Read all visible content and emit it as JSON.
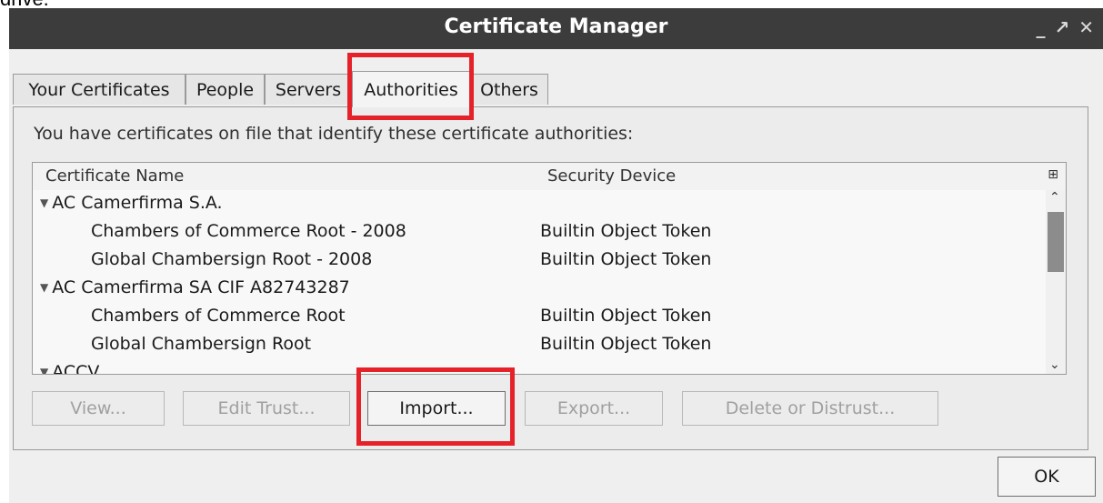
{
  "caption_fragment": "drive.",
  "window": {
    "title": "Certificate Manager",
    "controls": [
      "minimize-icon",
      "maximize-icon",
      "close-icon"
    ]
  },
  "tabs": [
    {
      "label": "Your Certificates",
      "active": false
    },
    {
      "label": "People",
      "active": false
    },
    {
      "label": "Servers",
      "active": false
    },
    {
      "label": "Authorities",
      "active": true
    },
    {
      "label": "Others",
      "active": false
    }
  ],
  "panel": {
    "prompt": "You have certificates on file that identify these certificate authorities:"
  },
  "tree": {
    "columns": {
      "name": "Certificate Name",
      "device": "Security Device"
    },
    "rows": [
      {
        "name": "AC Camerfirma S.A.",
        "device": "",
        "level": 0,
        "expanded": true
      },
      {
        "name": "Chambers of Commerce Root - 2008",
        "device": "Builtin Object Token",
        "level": 1
      },
      {
        "name": "Global Chambersign Root - 2008",
        "device": "Builtin Object Token",
        "level": 1
      },
      {
        "name": "AC Camerfirma SA CIF A82743287",
        "device": "",
        "level": 0,
        "expanded": true
      },
      {
        "name": "Chambers of Commerce Root",
        "device": "Builtin Object Token",
        "level": 1
      },
      {
        "name": "Global Chambersign Root",
        "device": "Builtin Object Token",
        "level": 1
      },
      {
        "name": "ACCV",
        "device": "",
        "level": 0,
        "expanded": true
      }
    ]
  },
  "buttons": {
    "view": "View...",
    "edit_trust": "Edit Trust...",
    "import": "Import...",
    "export": "Export...",
    "delete": "Delete or Distrust...",
    "ok": "OK"
  },
  "colors": {
    "titlebar": "#3c3c3c",
    "highlight": "#e5222a"
  }
}
